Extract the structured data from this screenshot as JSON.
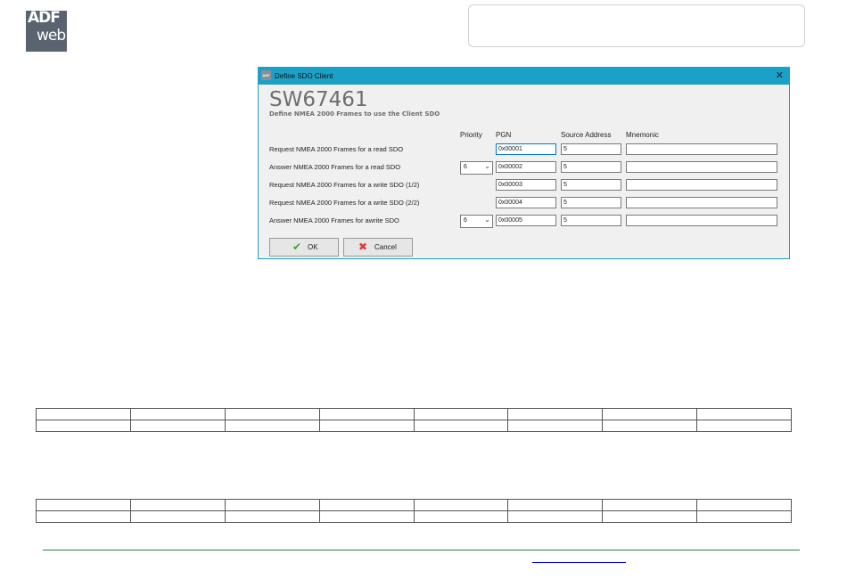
{
  "logo": {
    "line1": "ADF",
    "line2": "web"
  },
  "dialog": {
    "title": "Define SDO Client",
    "close_glyph": "✕",
    "heading": "SW67461",
    "subtitle": "Define NMEA 2000 Frames to use the Client SDO",
    "columns": {
      "priority": "Priority",
      "pgn": "PGN",
      "source_address": "Source Address",
      "mnemonic": "Mnemonic"
    },
    "rows": [
      {
        "label": "Request NMEA 2000 Frames for a read SDO",
        "priority": "",
        "pgn": "0x00001",
        "source_address": "5",
        "mnemonic": ""
      },
      {
        "label": "Answer NMEA 2000 Frames for a read SDO",
        "priority": "6",
        "pgn": "0x00002",
        "source_address": "5",
        "mnemonic": ""
      },
      {
        "label": "Request NMEA 2000 Frames for a write SDO (1/2)",
        "priority": "",
        "pgn": "0x00003",
        "source_address": "5",
        "mnemonic": ""
      },
      {
        "label": "Request NMEA 2000 Frames for a write SDO (2/2)",
        "priority": "",
        "pgn": "0x00004",
        "source_address": "5",
        "mnemonic": ""
      },
      {
        "label": "Answer NMEA 2000 Frames for awrite SDO",
        "priority": "6",
        "pgn": "0x00005",
        "source_address": "5",
        "mnemonic": ""
      }
    ],
    "buttons": {
      "ok": "OK",
      "cancel": "Cancel"
    },
    "icons": {
      "ok": "checkmark-icon",
      "cancel": "cross-icon"
    },
    "accent_color": "#1ba1c7"
  }
}
